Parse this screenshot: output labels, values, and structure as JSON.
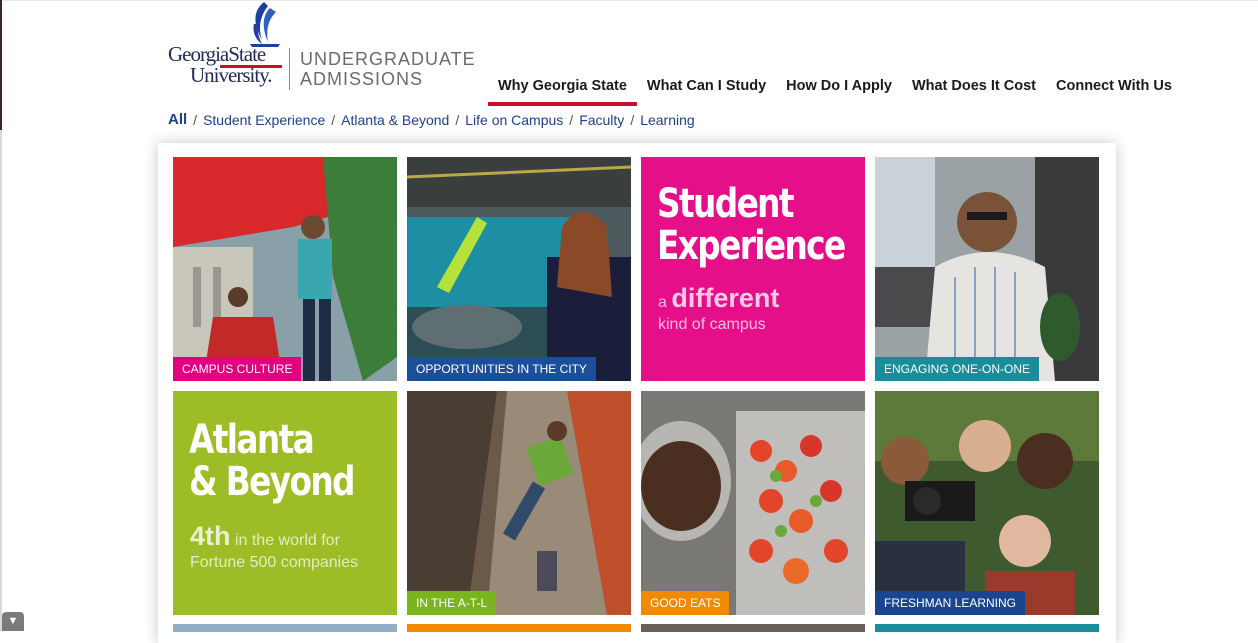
{
  "logo": {
    "line1": "GeorgiaState",
    "line2": "University.",
    "admissions_line1": "UNDERGRADUATE",
    "admissions_line2": "ADMISSIONS"
  },
  "nav": {
    "items": [
      {
        "label": "Why Georgia State",
        "active": true
      },
      {
        "label": "What Can I Study"
      },
      {
        "label": "How Do I Apply"
      },
      {
        "label": "What Does It Cost"
      },
      {
        "label": "Connect With Us"
      }
    ]
  },
  "breadcrumbs": [
    "All",
    "Student Experience",
    "Atlanta & Beyond",
    "Life on Campus",
    "Faculty",
    "Learning"
  ],
  "tiles": [
    {
      "label": "CAMPUS CULTURE"
    },
    {
      "label": "OPPORTUNITIES IN THE CITY"
    },
    {
      "title_line1": "Student",
      "title_line2": "Experience",
      "sub_small": "a",
      "sub_big": "different",
      "sub_line2": "kind of campus"
    },
    {
      "label": "ENGAGING ONE-ON-ONE"
    },
    {
      "title_line1": "Atlanta",
      "title_line2": "& Beyond",
      "sub_big": "4th",
      "sub_rest": "in the world for",
      "sub_line2": "Fortune 500 companies"
    },
    {
      "label": "IN THE A-T-L"
    },
    {
      "label": "GOOD EATS"
    },
    {
      "label": "FRESHMAN LEARNING"
    }
  ],
  "colors": {
    "brand_red": "#c8102e",
    "brand_blue": "#1f2a55",
    "link_blue": "#1d3f8f",
    "promo_pink": "#e60f8a",
    "promo_green": "#9cbd25"
  },
  "icons": {
    "scroll_down": "chevron-down-icon",
    "logo_mark": "flame-logo-icon"
  }
}
